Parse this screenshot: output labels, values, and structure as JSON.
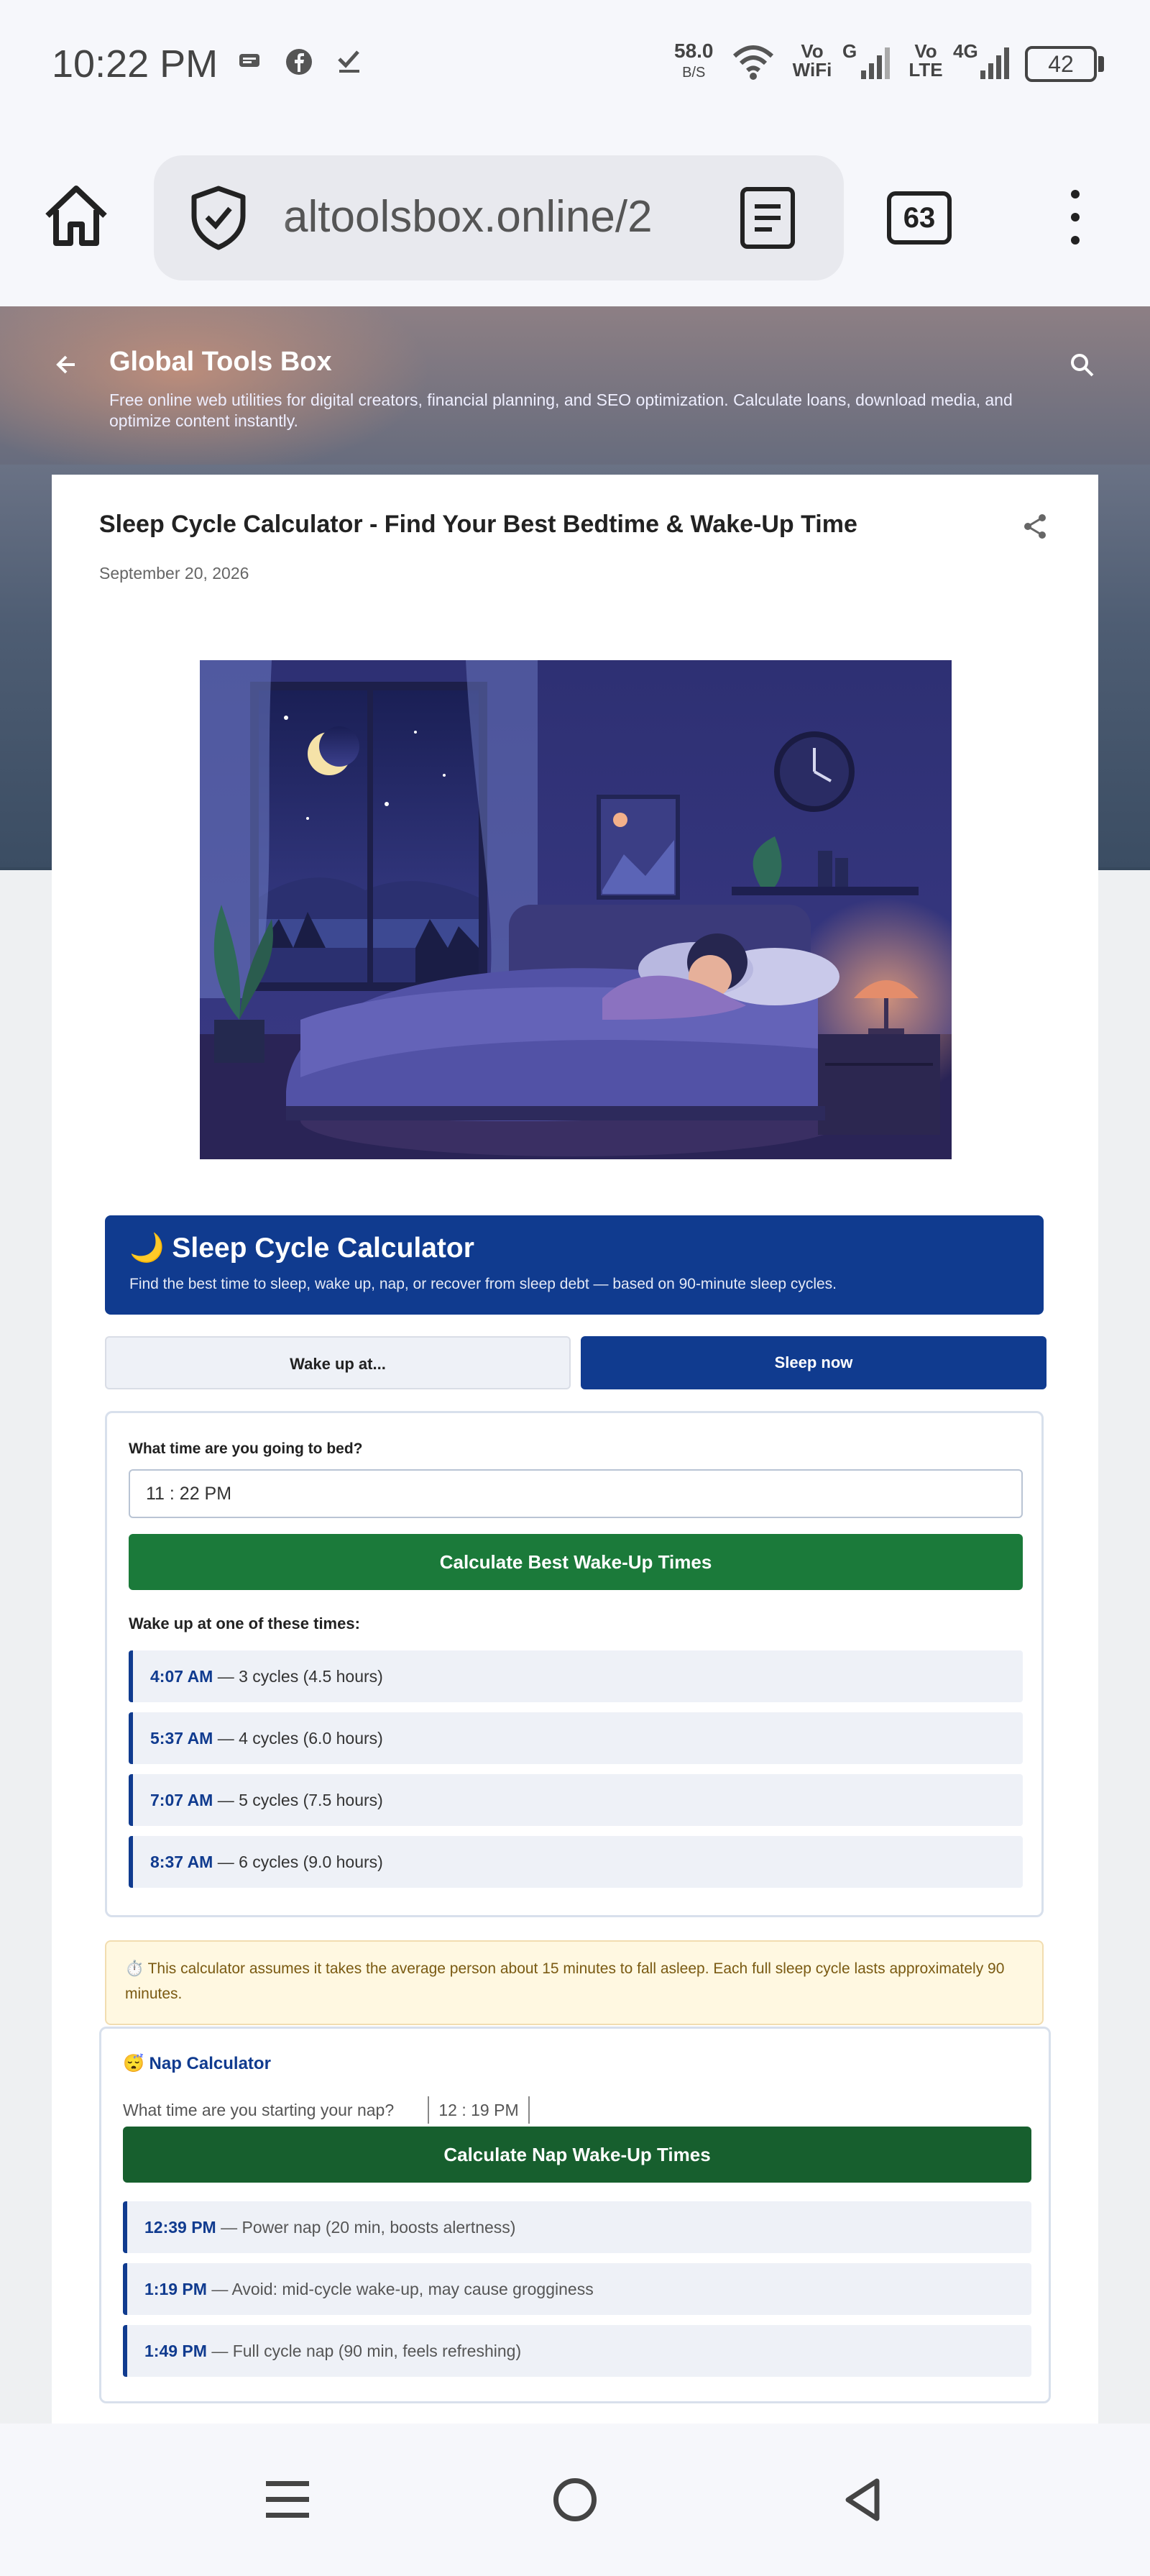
{
  "status_bar": {
    "time": "10:22 PM",
    "net_speed": "58.0",
    "net_unit": "B/S",
    "wifi_label": "Vo WiFi",
    "sig1_label": "G",
    "sig2_label": "Vo LTE",
    "sig3_label": "4G",
    "battery": "42"
  },
  "browser": {
    "url": "altoolsbox.online/2",
    "tab_count": "63"
  },
  "blog": {
    "title": "Global Tools Box",
    "description": "Free online web utilities for digital creators, financial planning, and SEO optimization. Calculate loans, download media, and optimize content instantly."
  },
  "post": {
    "title": "Sleep Cycle Calculator - Find Your Best Bedtime & Wake-Up Time",
    "date": "September 20, 2026"
  },
  "calculator": {
    "title": "🌙 Sleep Cycle Calculator",
    "subtitle": "Find the best time to sleep, wake up, nap, or recover from sleep debt — based on 90-minute sleep cycles.",
    "tabs": [
      {
        "label": "Wake up at...",
        "active": false
      },
      {
        "label": "Sleep now",
        "active": true
      }
    ],
    "bed_question": "What time are you going to bed?",
    "bed_time": "11 : 22  PM",
    "calc_button": "Calculate Best Wake-Up Times",
    "results_heading": "Wake up at one of these times:",
    "results": [
      {
        "time": "4:07 AM",
        "detail": " — 3 cycles (4.5 hours)"
      },
      {
        "time": "5:37 AM",
        "detail": " — 4 cycles (6.0 hours)"
      },
      {
        "time": "7:07 AM",
        "detail": " — 5 cycles (7.5 hours)"
      },
      {
        "time": "8:37 AM",
        "detail": " — 6 cycles (9.0 hours)"
      }
    ],
    "note": "⏱️ This calculator assumes it takes the average person about 15 minutes to fall asleep. Each full sleep cycle lasts approximately 90 minutes."
  },
  "nap": {
    "title": "😴 Nap Calculator",
    "question": "What time are you starting your nap?",
    "start_time": "12 : 19  PM",
    "button": "Calculate Nap Wake-Up Times",
    "results": [
      {
        "time": "12:39 PM",
        "detail": " — Power nap (20 min, boosts alertness)"
      },
      {
        "time": "1:19 PM",
        "detail": " — Avoid: mid-cycle wake-up, may cause grogginess"
      },
      {
        "time": "1:49 PM",
        "detail": " — Full cycle nap (90 min, feels refreshing)"
      }
    ]
  },
  "colors": {
    "primary": "#103b8f",
    "green": "#1b7a3a",
    "note_bg": "#fff8e1"
  }
}
